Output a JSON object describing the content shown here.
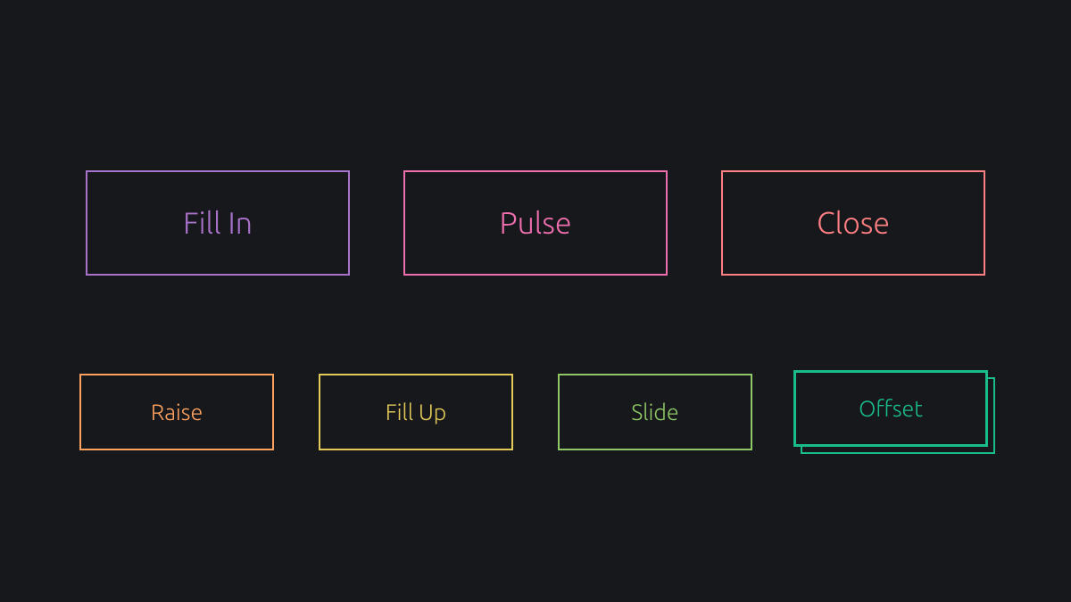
{
  "buttons": {
    "fill_in": {
      "label": "Fill In",
      "color": "#a972cb"
    },
    "pulse": {
      "label": "Pulse",
      "color": "#ef6eae"
    },
    "close": {
      "label": "Close",
      "color": "#ff7f82"
    },
    "raise": {
      "label": "Raise",
      "color": "#ffa260"
    },
    "fill_up": {
      "label": "Fill Up",
      "color": "#e4cb58"
    },
    "slide": {
      "label": "Slide",
      "color": "#8fc866"
    },
    "offset": {
      "label": "Offset",
      "color": "#19bc8b"
    }
  }
}
